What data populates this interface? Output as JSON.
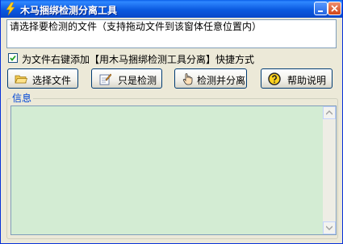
{
  "window": {
    "title": "木马捆绑检测分离工具",
    "minimize_icon": "minimize-icon",
    "close_icon": "close-icon"
  },
  "file_input": {
    "value": "请选择要检测的文件（支持拖动文件到该窗体任意位置内）"
  },
  "context_menu_option": {
    "checked": true,
    "label": "为文件右键添加【用木马捆绑检测工具分离】快捷方式"
  },
  "toolbar": {
    "select_file_label": "选择文件",
    "check_only_label": "只是检测",
    "check_split_label": "检测并分离",
    "help_label": "帮助说明",
    "select_file_icon": "folder-open-icon",
    "check_only_icon": "notepad-icon",
    "check_split_icon": "hand-pointer-icon",
    "help_icon": "help-icon"
  },
  "info_group": {
    "title": "信息",
    "content": ""
  },
  "colors": {
    "titlebar": "#0b5ae0",
    "info_background": "#d3ecd3",
    "group_title": "#0046d5"
  }
}
